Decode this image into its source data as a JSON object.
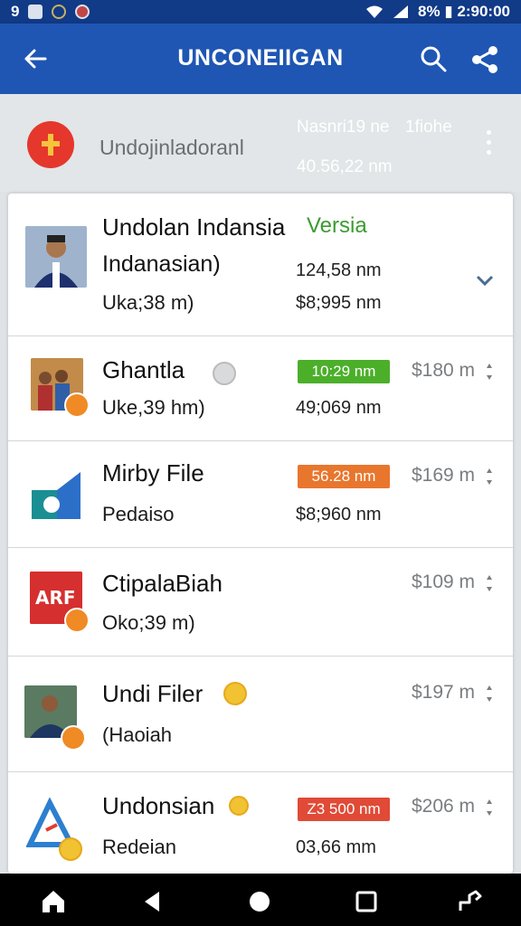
{
  "status_bar": {
    "left_text": "9",
    "right_text": "8% ▮ 2:90:00"
  },
  "app_bar": {
    "title": "UNCONEIIGAN"
  },
  "header": {
    "name": "Undojinladoranl",
    "meta1": "Nasnri19 ne",
    "meta1b": "1fiohe",
    "meta2": "40.56,22 nm"
  },
  "rows": [
    {
      "title": "Undolan Indansia",
      "title_accent": "Versia",
      "subtitle": "Indanasian)",
      "value1": "124,58 nm",
      "detail": "Uka;38 m)",
      "value2": "$8;995 nm"
    },
    {
      "title": "Ghantla",
      "subtitle": "Uke,39 hm)",
      "pill": "10:29 nm",
      "price": "$180 m",
      "value2": "49;069 nm"
    },
    {
      "title": "Mirby File",
      "subtitle": "Pedaiso",
      "pill": "56.28 nm",
      "price": "$169 m",
      "value2": "$8;960 nm"
    },
    {
      "title": "CtipalaBiah",
      "subtitle": "Oko;39 m)",
      "price": "$109 m"
    },
    {
      "title": "Undi Filer",
      "subtitle": "(Haoiah",
      "price": "$197 m"
    },
    {
      "title": "Undonsian",
      "subtitle": "Redeian",
      "pill": "Z3 500 nm",
      "price": "$206 m",
      "value2": "03,66 mm"
    }
  ],
  "colors": {
    "appbar": "#1f56b3",
    "status": "#113a87",
    "green": "#4caf2a",
    "orange": "#e8762d",
    "red": "#e04a36"
  }
}
